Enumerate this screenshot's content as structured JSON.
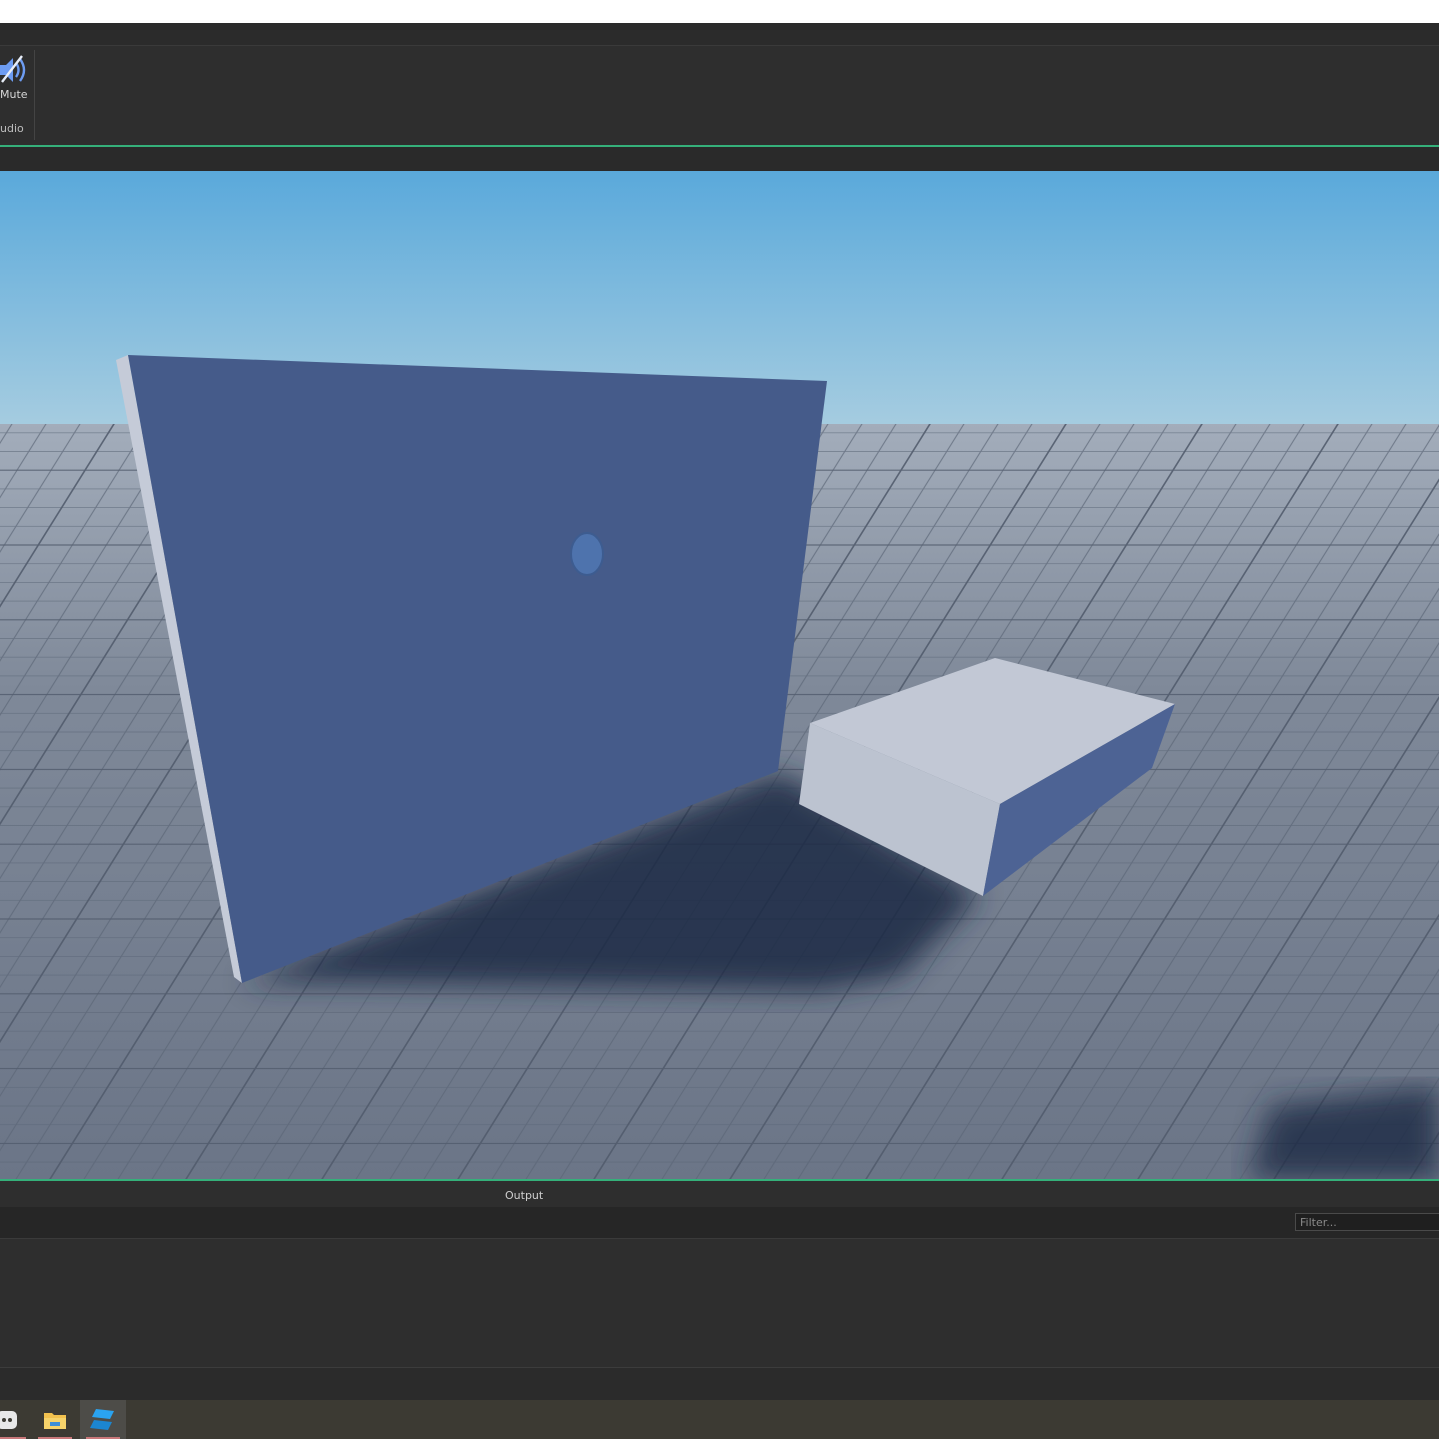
{
  "ribbon": {
    "mute_label": "Mute",
    "group_label": "udio"
  },
  "output": {
    "title": "Output",
    "filter_placeholder": "Filter..."
  },
  "taskbar": {
    "items": [
      "discord-icon",
      "file-explorer-icon",
      "roblox-studio-icon"
    ],
    "active": "roblox-studio-icon"
  },
  "colors": {
    "accent": "#35b07a",
    "panel_bg": "#2e2e2e",
    "sky_top": "#5aa9db",
    "sky_bottom": "#a7cde0",
    "baseplate": "#6e7889",
    "part_blue": "#455b8a",
    "part_light": "#c1c7d4"
  }
}
